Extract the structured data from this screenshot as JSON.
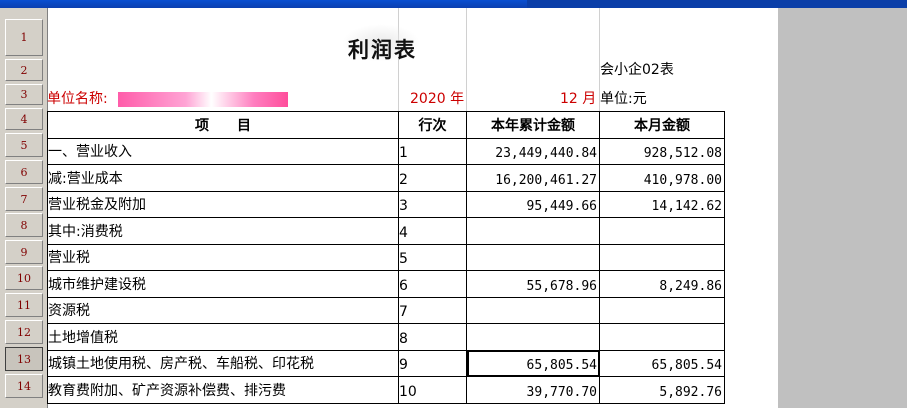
{
  "report": {
    "title": "利润表",
    "form_code": "会小企02表",
    "unit_label": "单位名称:",
    "year": "2020 年",
    "month": "12 月",
    "currency_unit": "单位:元"
  },
  "row_numbers": [
    "1",
    "2",
    "3",
    "4",
    "5",
    "6",
    "7",
    "8",
    "9",
    "10",
    "11",
    "12",
    "13",
    "14"
  ],
  "active_row": "13",
  "columns": [
    "项　　目",
    "行次",
    "本年累计金额",
    "本月金额"
  ],
  "rows": [
    {
      "item": "一、营业收入",
      "line": "1",
      "ytd": "23,449,440.84",
      "month": "928,512.08",
      "indent": 0
    },
    {
      "item": "减:营业成本",
      "line": "2",
      "ytd": "16,200,461.27",
      "month": "410,978.00",
      "indent": 0
    },
    {
      "item": "营业税金及附加",
      "line": "3",
      "ytd": "95,449.66",
      "month": "14,142.62",
      "indent": 0
    },
    {
      "item": "其中:消费税",
      "line": "4",
      "ytd": "",
      "month": "",
      "indent": 1
    },
    {
      "item": "营业税",
      "line": "5",
      "ytd": "",
      "month": "",
      "indent": 2
    },
    {
      "item": "城市维护建设税",
      "line": "6",
      "ytd": "55,678.96",
      "month": "8,249.86",
      "indent": 2
    },
    {
      "item": "资源税",
      "line": "7",
      "ytd": "",
      "month": "",
      "indent": 2
    },
    {
      "item": "土地增值税",
      "line": "8",
      "ytd": "",
      "month": "",
      "indent": 2
    },
    {
      "item": "城镇土地使用税、房产税、车船税、印花税",
      "line": "9",
      "ytd": "65,805.54",
      "month": "65,805.54",
      "indent": 2
    },
    {
      "item": "教育费附加、矿产资源补偿费、排污费",
      "line": "10",
      "ytd": "39,770.70",
      "month": "5,892.76",
      "indent": 2
    }
  ],
  "colors": {
    "label_red": "#cc0000",
    "titlebar_blue": "#0a4fd1",
    "row_header_text": "#800000"
  }
}
